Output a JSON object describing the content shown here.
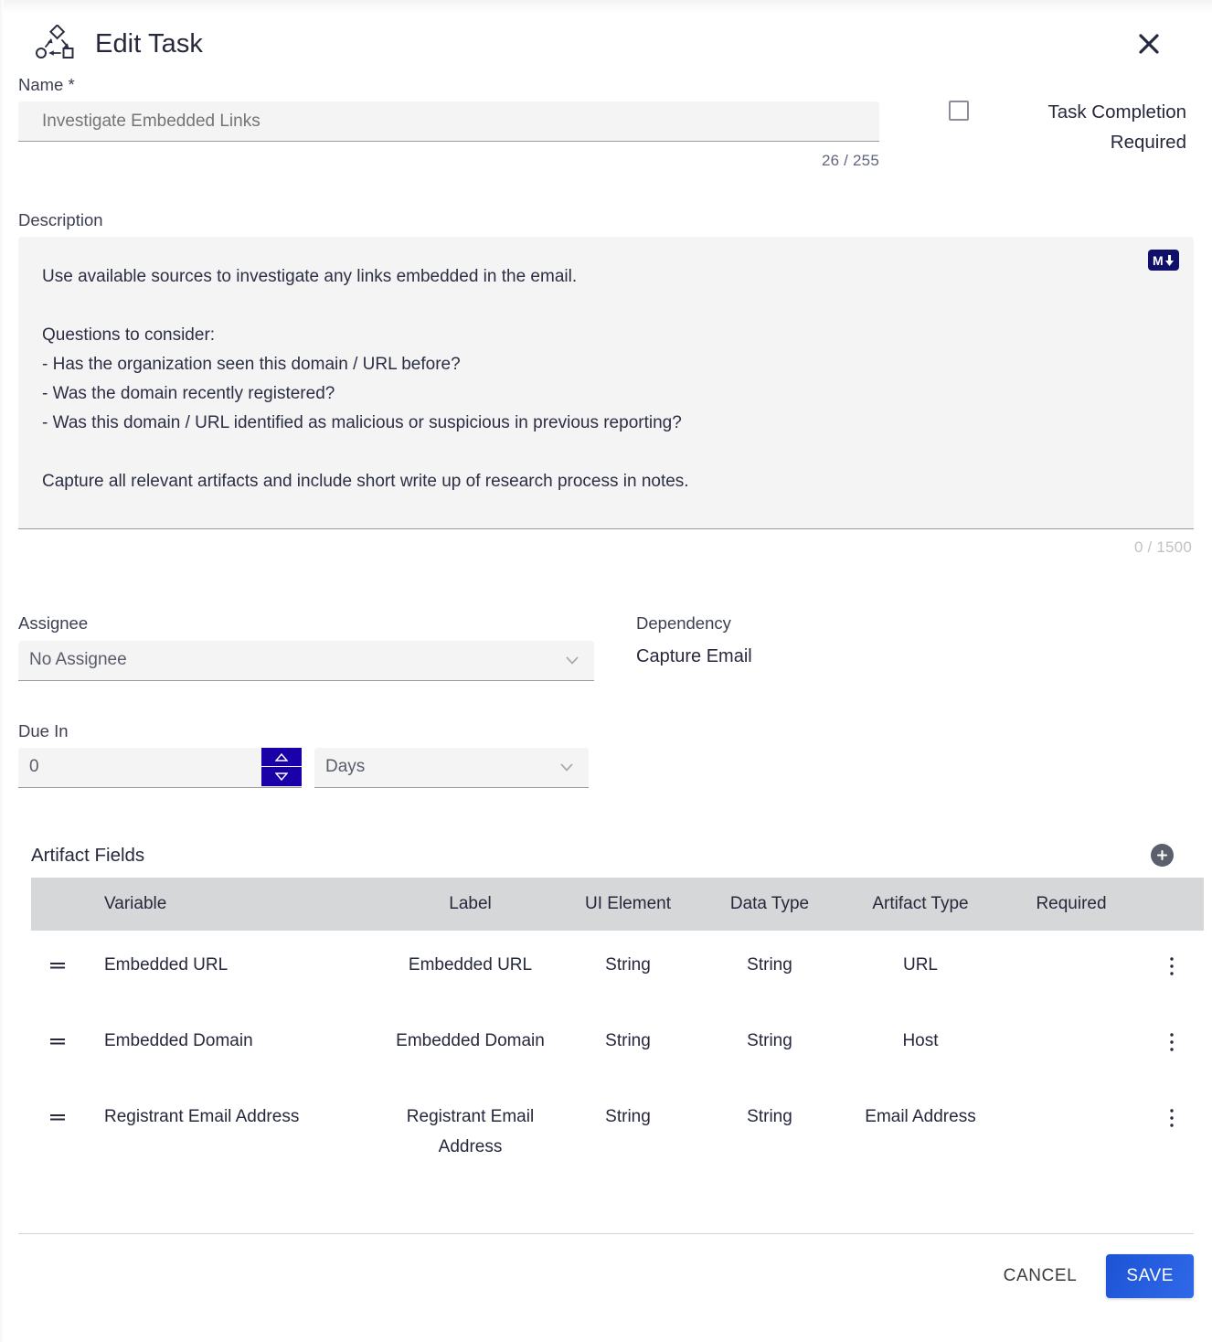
{
  "dialog": {
    "title": "Edit Task",
    "icon": "workflow-icon",
    "close_icon": "close-icon"
  },
  "name_field": {
    "label": "Name *",
    "value": "Investigate Embedded Links",
    "placeholder": "Investigate Embedded Links",
    "counter": "26 / 255"
  },
  "task_completion": {
    "label": "Task Completion Required",
    "checked": false
  },
  "description_field": {
    "label": "Description",
    "value": "Use available sources to investigate any links embedded in the email.\n\nQuestions to consider:\n- Has the organization seen this domain / URL before?\n- Was the domain recently registered?\n- Was this domain / URL identified as malicious or suspicious in previous reporting?\n\nCapture all relevant artifacts and include short write up of research process in notes.",
    "counter": "0 / 1500",
    "markdown_badge": "M"
  },
  "assignee": {
    "label": "Assignee",
    "value": "No Assignee",
    "chevron_icon": "chevron-down-icon"
  },
  "dependency": {
    "label": "Dependency",
    "value": "Capture Email"
  },
  "due_in": {
    "label": "Due In",
    "value": "0",
    "unit": "Days",
    "increment_icon": "triangle-up-icon",
    "decrement_icon": "triangle-down-icon"
  },
  "artifact_fields": {
    "title": "Artifact Fields",
    "add_icon": "plus-icon",
    "columns": [
      "Variable",
      "Label",
      "UI Element",
      "Data Type",
      "Artifact Type",
      "Required"
    ],
    "rows": [
      {
        "variable": "Embedded URL",
        "label": "Embedded URL",
        "ui_element": "String",
        "data_type": "String",
        "artifact_type": "URL",
        "required": ""
      },
      {
        "variable": "Embedded Domain",
        "label": "Embedded Domain",
        "ui_element": "String",
        "data_type": "String",
        "artifact_type": "Host",
        "required": ""
      },
      {
        "variable": "Registrant Email Address",
        "label": "Registrant Email Address",
        "ui_element": "String",
        "data_type": "String",
        "artifact_type": "Email Address",
        "required": ""
      }
    ]
  },
  "footer": {
    "cancel_label": "CANCEL",
    "save_label": "SAVE"
  },
  "colors": {
    "accent_blue": "#2b63e3",
    "spinner_navy": "#1a00a8",
    "markdown_navy": "#10106b",
    "table_header_gray": "#d6d7d9",
    "field_gray": "#f4f4f4",
    "text_dark": "#26283c"
  }
}
